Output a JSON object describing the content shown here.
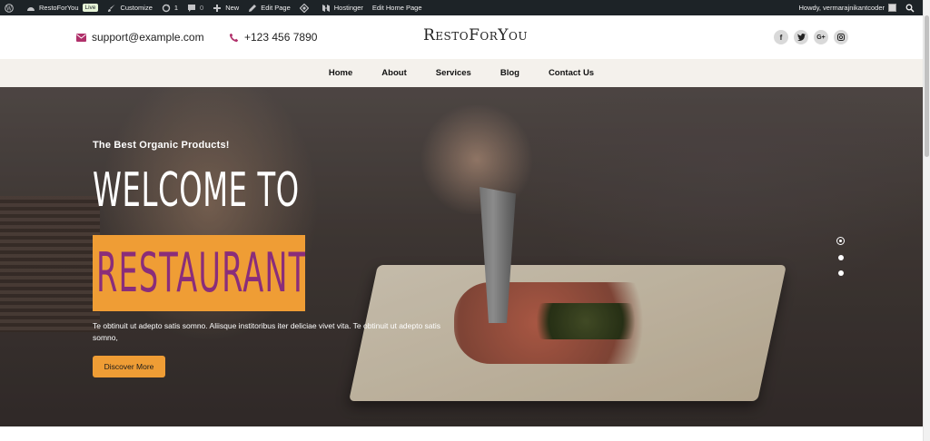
{
  "admin_bar": {
    "site_name": "RestoForYou",
    "live_badge": "Live",
    "customize": "Customize",
    "updates_count": "1",
    "comments_count": "0",
    "new": "New",
    "edit_page": "Edit Page",
    "hostinger": "Hostinger",
    "edit_home_page": "Edit Home Page",
    "howdy": "Howdy, vermarajnikantcoder"
  },
  "header": {
    "email": "support@example.com",
    "phone": "+123 456 7890",
    "logo": "RestoForYou",
    "social_icons": [
      "facebook-icon",
      "twitter-icon",
      "google-plus-icon",
      "instagram-icon"
    ]
  },
  "nav": {
    "items": [
      "Home",
      "About",
      "Services",
      "Blog",
      "Contact Us"
    ]
  },
  "hero": {
    "tagline": "The Best Organic Products!",
    "headline": "WELCOME TO",
    "highlight": "RESTAURANT!",
    "description": "Te obtinuit ut adepto satis somno. Aliisque institoribus iter deliciae vivet vita. Te obtinuit ut adepto satis somno,",
    "cta": "Discover More",
    "slides_total": 3,
    "active_slide": 1
  },
  "colors": {
    "accent": "#ef9d35",
    "highlight_text": "#8a2d7a",
    "email_icon": "#b0306a",
    "admin_bar": "#1d2327",
    "nav_bg": "#f4f1ec"
  }
}
